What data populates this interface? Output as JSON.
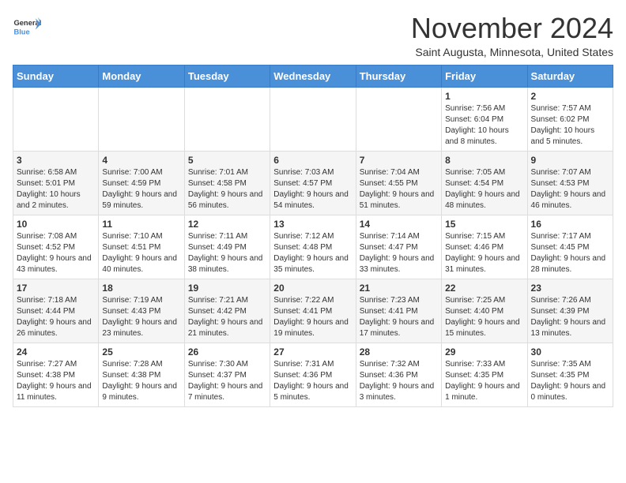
{
  "header": {
    "logo_general": "General",
    "logo_blue": "Blue",
    "month_title": "November 2024",
    "location": "Saint Augusta, Minnesota, United States"
  },
  "weekdays": [
    "Sunday",
    "Monday",
    "Tuesday",
    "Wednesday",
    "Thursday",
    "Friday",
    "Saturday"
  ],
  "weeks": [
    [
      {
        "day": "",
        "info": ""
      },
      {
        "day": "",
        "info": ""
      },
      {
        "day": "",
        "info": ""
      },
      {
        "day": "",
        "info": ""
      },
      {
        "day": "",
        "info": ""
      },
      {
        "day": "1",
        "info": "Sunrise: 7:56 AM\nSunset: 6:04 PM\nDaylight: 10 hours and 8 minutes."
      },
      {
        "day": "2",
        "info": "Sunrise: 7:57 AM\nSunset: 6:02 PM\nDaylight: 10 hours and 5 minutes."
      }
    ],
    [
      {
        "day": "3",
        "info": "Sunrise: 6:58 AM\nSunset: 5:01 PM\nDaylight: 10 hours and 2 minutes."
      },
      {
        "day": "4",
        "info": "Sunrise: 7:00 AM\nSunset: 4:59 PM\nDaylight: 9 hours and 59 minutes."
      },
      {
        "day": "5",
        "info": "Sunrise: 7:01 AM\nSunset: 4:58 PM\nDaylight: 9 hours and 56 minutes."
      },
      {
        "day": "6",
        "info": "Sunrise: 7:03 AM\nSunset: 4:57 PM\nDaylight: 9 hours and 54 minutes."
      },
      {
        "day": "7",
        "info": "Sunrise: 7:04 AM\nSunset: 4:55 PM\nDaylight: 9 hours and 51 minutes."
      },
      {
        "day": "8",
        "info": "Sunrise: 7:05 AM\nSunset: 4:54 PM\nDaylight: 9 hours and 48 minutes."
      },
      {
        "day": "9",
        "info": "Sunrise: 7:07 AM\nSunset: 4:53 PM\nDaylight: 9 hours and 46 minutes."
      }
    ],
    [
      {
        "day": "10",
        "info": "Sunrise: 7:08 AM\nSunset: 4:52 PM\nDaylight: 9 hours and 43 minutes."
      },
      {
        "day": "11",
        "info": "Sunrise: 7:10 AM\nSunset: 4:51 PM\nDaylight: 9 hours and 40 minutes."
      },
      {
        "day": "12",
        "info": "Sunrise: 7:11 AM\nSunset: 4:49 PM\nDaylight: 9 hours and 38 minutes."
      },
      {
        "day": "13",
        "info": "Sunrise: 7:12 AM\nSunset: 4:48 PM\nDaylight: 9 hours and 35 minutes."
      },
      {
        "day": "14",
        "info": "Sunrise: 7:14 AM\nSunset: 4:47 PM\nDaylight: 9 hours and 33 minutes."
      },
      {
        "day": "15",
        "info": "Sunrise: 7:15 AM\nSunset: 4:46 PM\nDaylight: 9 hours and 31 minutes."
      },
      {
        "day": "16",
        "info": "Sunrise: 7:17 AM\nSunset: 4:45 PM\nDaylight: 9 hours and 28 minutes."
      }
    ],
    [
      {
        "day": "17",
        "info": "Sunrise: 7:18 AM\nSunset: 4:44 PM\nDaylight: 9 hours and 26 minutes."
      },
      {
        "day": "18",
        "info": "Sunrise: 7:19 AM\nSunset: 4:43 PM\nDaylight: 9 hours and 23 minutes."
      },
      {
        "day": "19",
        "info": "Sunrise: 7:21 AM\nSunset: 4:42 PM\nDaylight: 9 hours and 21 minutes."
      },
      {
        "day": "20",
        "info": "Sunrise: 7:22 AM\nSunset: 4:41 PM\nDaylight: 9 hours and 19 minutes."
      },
      {
        "day": "21",
        "info": "Sunrise: 7:23 AM\nSunset: 4:41 PM\nDaylight: 9 hours and 17 minutes."
      },
      {
        "day": "22",
        "info": "Sunrise: 7:25 AM\nSunset: 4:40 PM\nDaylight: 9 hours and 15 minutes."
      },
      {
        "day": "23",
        "info": "Sunrise: 7:26 AM\nSunset: 4:39 PM\nDaylight: 9 hours and 13 minutes."
      }
    ],
    [
      {
        "day": "24",
        "info": "Sunrise: 7:27 AM\nSunset: 4:38 PM\nDaylight: 9 hours and 11 minutes."
      },
      {
        "day": "25",
        "info": "Sunrise: 7:28 AM\nSunset: 4:38 PM\nDaylight: 9 hours and 9 minutes."
      },
      {
        "day": "26",
        "info": "Sunrise: 7:30 AM\nSunset: 4:37 PM\nDaylight: 9 hours and 7 minutes."
      },
      {
        "day": "27",
        "info": "Sunrise: 7:31 AM\nSunset: 4:36 PM\nDaylight: 9 hours and 5 minutes."
      },
      {
        "day": "28",
        "info": "Sunrise: 7:32 AM\nSunset: 4:36 PM\nDaylight: 9 hours and 3 minutes."
      },
      {
        "day": "29",
        "info": "Sunrise: 7:33 AM\nSunset: 4:35 PM\nDaylight: 9 hours and 1 minute."
      },
      {
        "day": "30",
        "info": "Sunrise: 7:35 AM\nSunset: 4:35 PM\nDaylight: 9 hours and 0 minutes."
      }
    ]
  ]
}
